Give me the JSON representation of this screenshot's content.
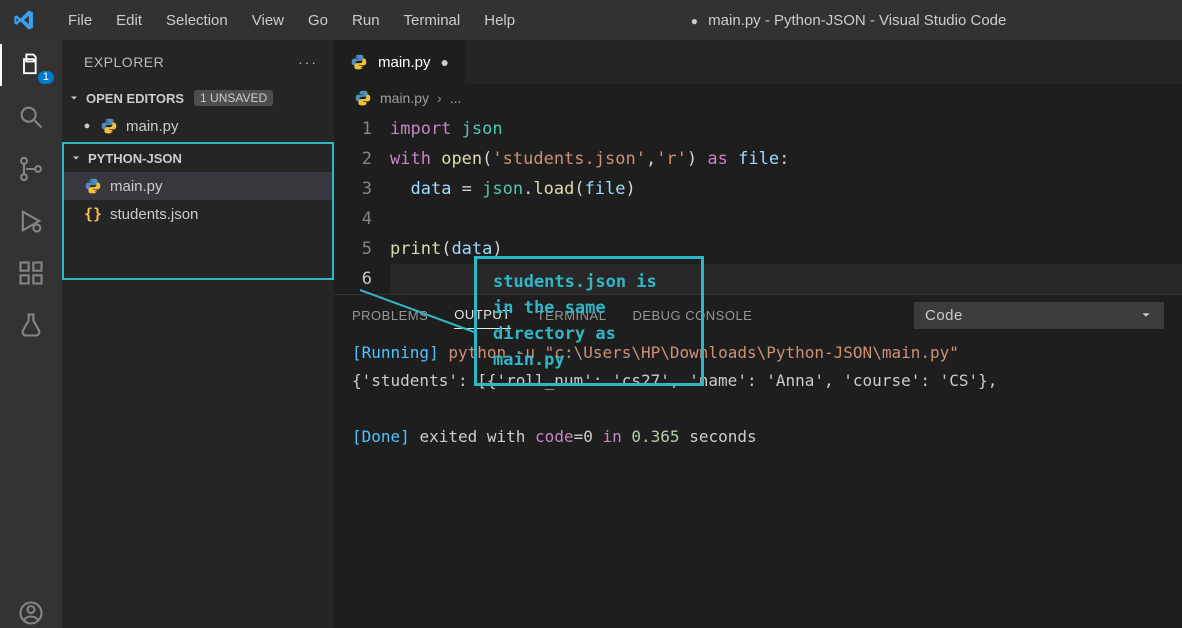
{
  "title_bar": {
    "menus": [
      "File",
      "Edit",
      "Selection",
      "View",
      "Go",
      "Run",
      "Terminal",
      "Help"
    ],
    "mod_indicator": "●",
    "window_title": "main.py - Python-JSON - Visual Studio Code"
  },
  "activity_bar": {
    "files_badge": "1"
  },
  "sidebar": {
    "title": "EXPLORER",
    "open_editors_label": "OPEN EDITORS",
    "unsaved_badge": "1 UNSAVED",
    "open_editors": [
      {
        "name": "main.py",
        "modified": true,
        "icon": "python"
      }
    ],
    "project_name": "PYTHON-JSON",
    "files": [
      {
        "name": "main.py",
        "icon": "python",
        "selected": true
      },
      {
        "name": "students.json",
        "icon": "json",
        "selected": false
      }
    ]
  },
  "editor": {
    "tab": {
      "name": "main.py",
      "modified": true
    },
    "breadcrumb": {
      "file": "main.py",
      "rest": "..."
    },
    "code": {
      "l1_import": "import",
      "l1_json": "json",
      "l2_with": "with",
      "l2_open": "open",
      "l2_str1": "'students.json'",
      "l2_str2": "'r'",
      "l2_as": "as",
      "l2_file": "file",
      "l3_data": "data",
      "l3_json": "json",
      "l3_load": "load",
      "l3_file": "file",
      "l5_print": "print",
      "l5_data": "data",
      "line_numbers": [
        "1",
        "2",
        "3",
        "4",
        "5",
        "6"
      ]
    }
  },
  "annotation": {
    "text": "students.json is in the same directory as main.py"
  },
  "panel": {
    "tabs": [
      "PROBLEMS",
      "OUTPUT",
      "TERMINAL",
      "DEBUG CONSOLE"
    ],
    "active_tab": "OUTPUT",
    "selector": "Code",
    "out_running_tag": "[Running]",
    "out_running_cmd": "python -u \"c:\\Users\\HP\\Downloads\\Python-JSON\\main.py\"",
    "out_result": "{'students': [{'roll_num': 'cs27', 'name': 'Anna', 'course': 'CS'},",
    "out_done_tag": "[Done]",
    "out_done_1": "exited with",
    "out_done_code_label": "code",
    "out_done_code_val": "=0",
    "out_done_in": "in",
    "out_done_time": "0.365",
    "out_done_sec": "seconds"
  }
}
